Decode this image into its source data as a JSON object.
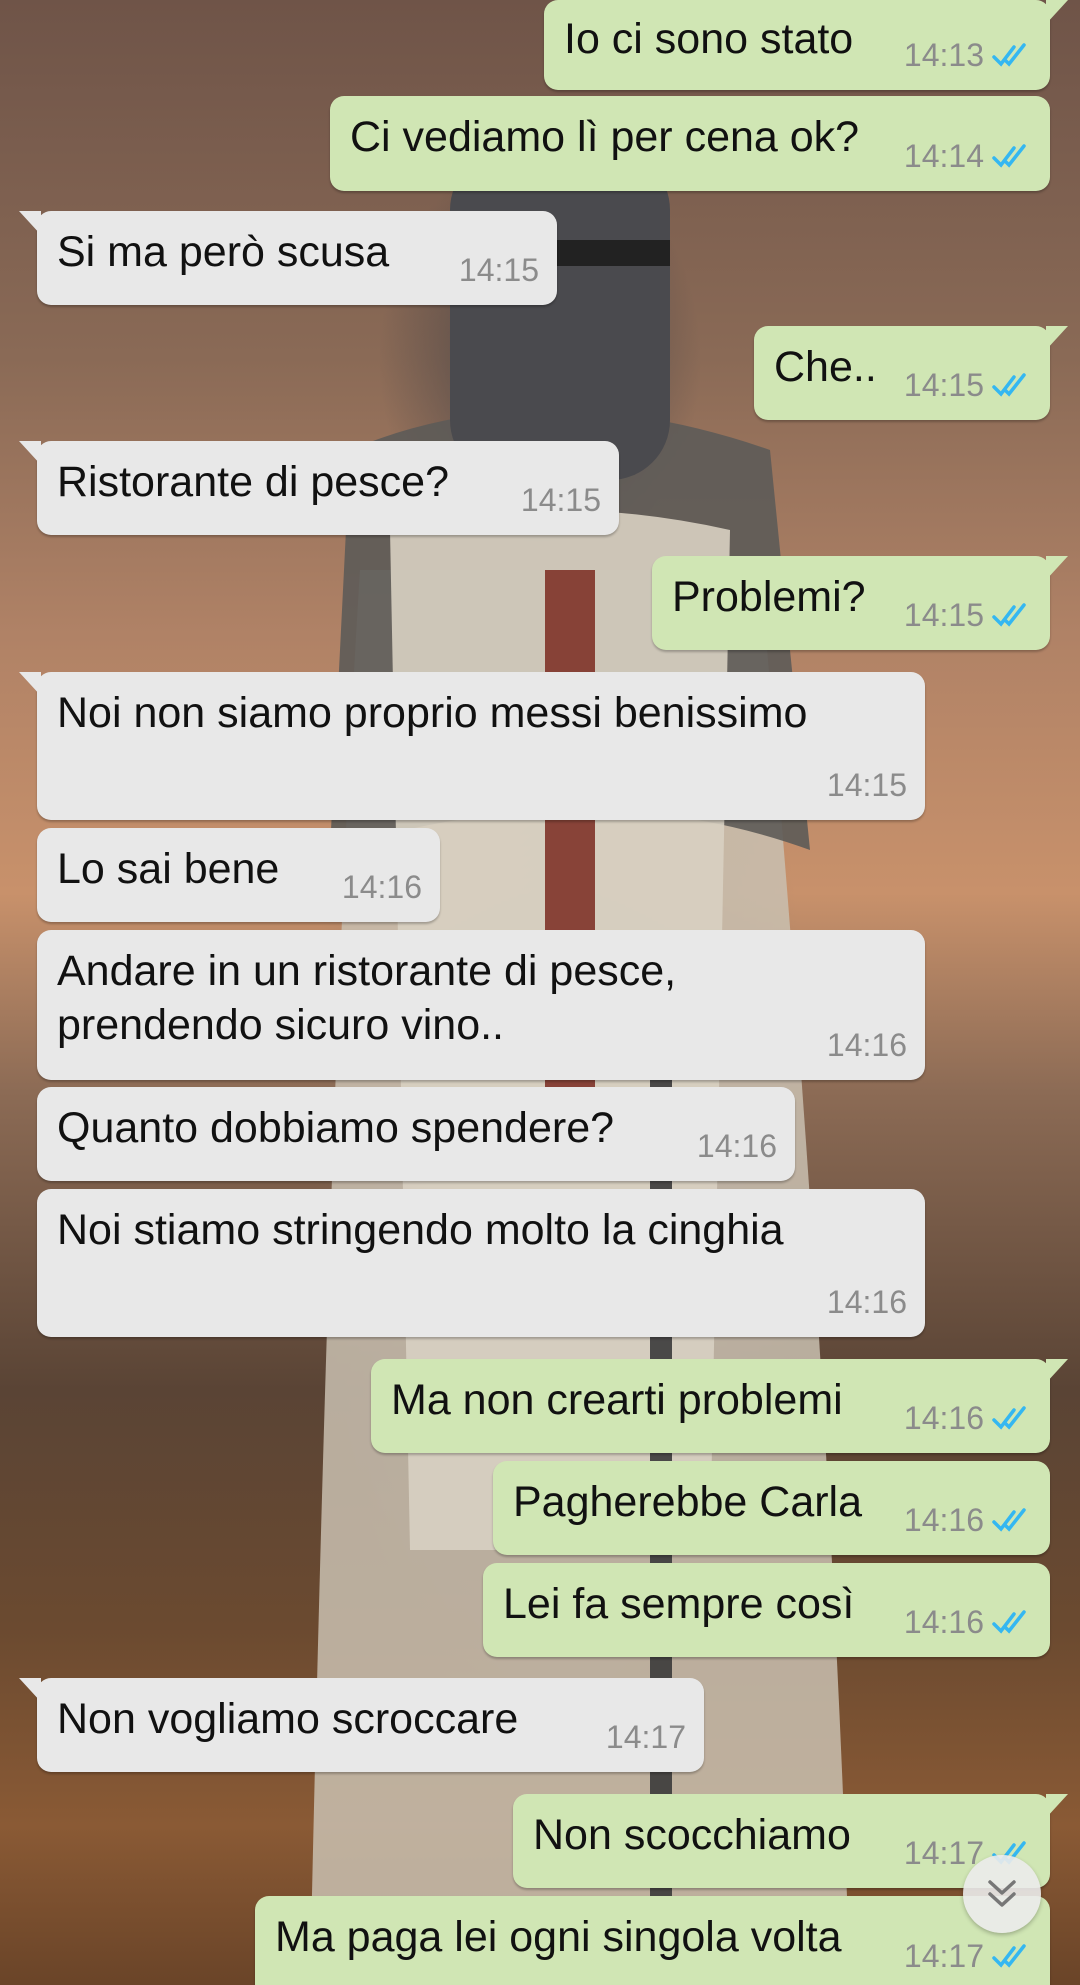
{
  "chat": {
    "messages": [
      {
        "dir": "out",
        "text": "Io ci sono stato",
        "time": "14:13"
      },
      {
        "dir": "out",
        "text": "Ci vediamo lì per cena ok?",
        "time": "14:14"
      },
      {
        "dir": "in",
        "text": "Si ma però scusa",
        "time": "14:15"
      },
      {
        "dir": "out",
        "text": "Che..",
        "time": "14:15"
      },
      {
        "dir": "in",
        "text": "Ristorante di pesce?",
        "time": "14:15"
      },
      {
        "dir": "out",
        "text": "Problemi?",
        "time": "14:15"
      },
      {
        "dir": "in",
        "text": "Noi non siamo proprio messi benissimo",
        "time": "14:15"
      },
      {
        "dir": "in",
        "text": "Lo sai bene",
        "time": "14:16"
      },
      {
        "dir": "in",
        "text_line1": "Andare in un ristorante di pesce,",
        "text_line2": "prendendo sicuro vino..",
        "time": "14:16"
      },
      {
        "dir": "in",
        "text": "Quanto dobbiamo spendere?",
        "time": "14:16"
      },
      {
        "dir": "in",
        "text": "Noi stiamo stringendo molto la cinghia",
        "time": "14:16"
      },
      {
        "dir": "out",
        "text": "Ma non crearti problemi",
        "time": "14:16"
      },
      {
        "dir": "out",
        "text": "Pagherebbe Carla",
        "time": "14:16"
      },
      {
        "dir": "out",
        "text": "Lei fa sempre così",
        "time": "14:16"
      },
      {
        "dir": "in",
        "text": "Non vogliamo scroccare",
        "time": "14:17"
      },
      {
        "dir": "out",
        "text": "Non scocchiamo",
        "time": "14:17"
      },
      {
        "dir": "out",
        "text": "Ma paga lei ogni singola volta",
        "time": "14:17"
      }
    ],
    "read_receipt_icon": "double-check-icon",
    "scroll_button_icon": "double-chevron-down-icon"
  },
  "colors": {
    "incoming_bubble": "#e8e8e8",
    "outgoing_bubble": "#d0e6b4",
    "read_check": "#34b7f1",
    "timestamp": "#8b8b8b"
  }
}
